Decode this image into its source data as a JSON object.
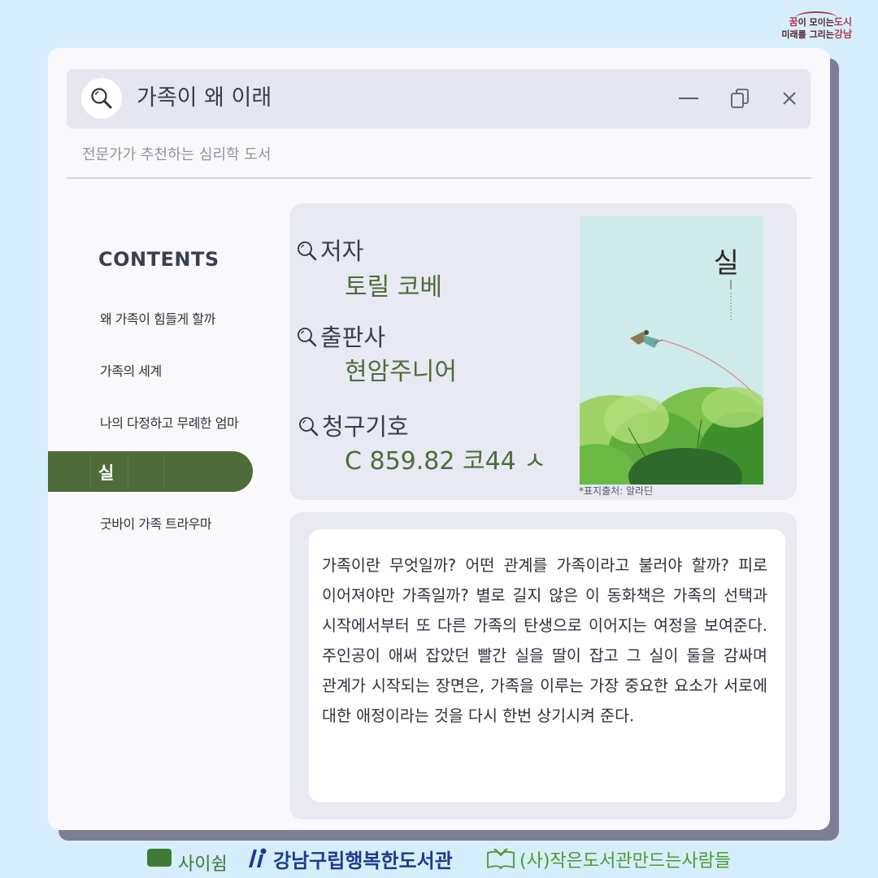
{
  "brand": {
    "line1_a": "꿈",
    "line1_b": "이 모이는",
    "line1_c": "도시",
    "line2_a": "미래",
    "line2_b": "를 그리는",
    "line2_c": "강남"
  },
  "search": {
    "title": "가족이 왜 이래",
    "icon": "search-icon"
  },
  "window_controls": {
    "minimize_icon": "minimize-icon",
    "copy_icon": "copy-icon",
    "close_icon": "close-icon"
  },
  "subtitle": "전문가가 추천하는 심리학 도서",
  "contents": {
    "heading": "CONTENTS",
    "items": [
      "왜 가족이 힘들게 할까",
      "가족의 세계",
      "나의 다정하고 무례한 엄마",
      "실",
      "굿바이 가족 트라우마"
    ],
    "active_index": 3
  },
  "book": {
    "author_label": "저자",
    "author": "토릴 코베",
    "publisher_label": "출판사",
    "publisher": "현암주니어",
    "call_number_label": "청구기호",
    "call_number": "C 859.82 코44 ㅅ",
    "cover_title": "실",
    "cover_caption": "*표지출처: 알라딘",
    "description": "가족이란 무엇일까? 어떤 관계를 가족이라고 불러야 할까? 피로 이어져야만 가족일까? 별로 길지 않은 이 동화책은 가족의 선택과 시작에서부터 또 다른 가족의 탄생으로 이어지는 여정을 보여준다. 주인공이 애써 잡았던 빨간 실을 딸이 잡고 그 실이 둘을 감싸며 관계가 시작되는 장면은, 가족을 이루는 가장 중요한 요소가 서로에 대한 애정이라는 것을 다시 한번 상기시켜 준다."
  },
  "footer": {
    "logo1_name": "사이쉼",
    "logo2_name": "강남구립행복한도서관",
    "logo3_name": "(사)작은도서관만드는사람들"
  },
  "colors": {
    "background": "#d6eefb",
    "accent_green": "#4f6b3a",
    "card": "#e8e9f2"
  }
}
